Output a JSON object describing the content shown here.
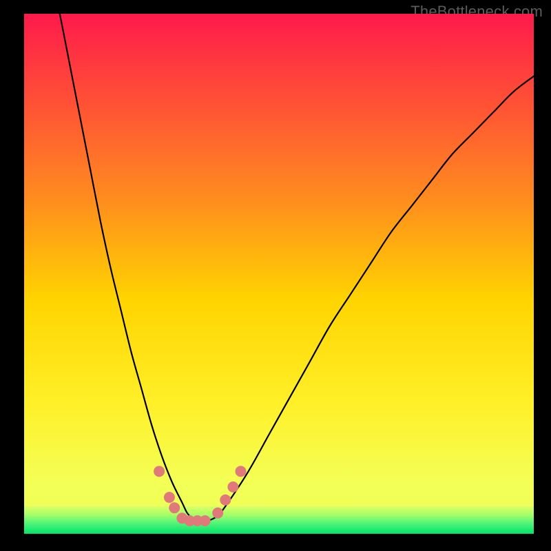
{
  "watermark": "TheBottleneck.com",
  "chart_data": {
    "type": "line",
    "title": "",
    "xlabel": "",
    "ylabel": "",
    "xlim": [
      0,
      100
    ],
    "ylim": [
      0,
      100
    ],
    "gradient_colors": {
      "top": "#ff1a4b",
      "upper_mid": "#ffb300",
      "mid": "#ffe600",
      "lower": "#eaff59",
      "bottom_band_top": "#dcff66",
      "bottom_band_bottom": "#00e56a"
    },
    "series": [
      {
        "name": "bottleneck-curve",
        "color": "#000000",
        "x": [
          7,
          9,
          11,
          13,
          15,
          17,
          19,
          21,
          23,
          25,
          27,
          29,
          31,
          32,
          33,
          34,
          36,
          38,
          40,
          44,
          48,
          52,
          56,
          60,
          64,
          68,
          72,
          76,
          80,
          84,
          88,
          92,
          96,
          100
        ],
        "y": [
          100,
          90,
          80,
          70,
          60,
          51,
          43,
          35,
          28,
          21,
          15,
          10,
          6,
          4,
          3,
          2.5,
          2.5,
          3.5,
          6,
          12,
          19,
          26,
          33,
          40,
          46,
          52,
          58,
          63,
          68,
          73,
          77,
          81,
          85,
          88
        ]
      }
    ],
    "markers": {
      "name": "highlighted-points",
      "color": "#e07a7a",
      "points": [
        {
          "x": 26.5,
          "y": 12
        },
        {
          "x": 28.5,
          "y": 7
        },
        {
          "x": 29.5,
          "y": 5
        },
        {
          "x": 31,
          "y": 3
        },
        {
          "x": 32.5,
          "y": 2.5
        },
        {
          "x": 34,
          "y": 2.5
        },
        {
          "x": 35.5,
          "y": 2.5
        },
        {
          "x": 38,
          "y": 4
        },
        {
          "x": 39.5,
          "y": 6.5
        },
        {
          "x": 41,
          "y": 9
        },
        {
          "x": 42.5,
          "y": 12
        }
      ]
    }
  }
}
